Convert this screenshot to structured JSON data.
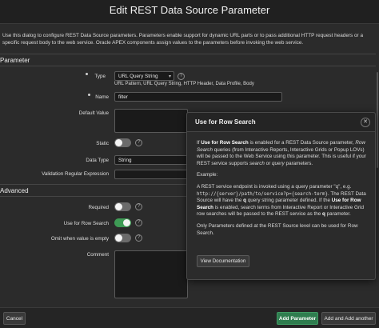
{
  "dialog": {
    "title": "Edit REST Data Source Parameter",
    "intro": "Use this dialog to configure REST Data Source parameters. Parameters enable support for dynamic URL parts or to pass additional HTTP request headers or a specific request body to the web service. Oracle APEX components assign values to the parameters before invoking the web service."
  },
  "parameter_section": {
    "heading": "Parameter",
    "type_label": "Type",
    "type_value": "URL Query String",
    "type_links": "URL Pattern, URL Query String, HTTP Header, Data Profile, Body",
    "name_label": "Name",
    "name_value": "filter",
    "default_label": "Default Value",
    "static_label": "Static",
    "datatype_label": "Data Type",
    "datatype_value": "String",
    "validation_label": "Validation Regular Expression"
  },
  "advanced_section": {
    "heading": "Advanced",
    "required_label": "Required",
    "row_search_label": "Use for Row Search",
    "omit_label": "Omit when value is empty",
    "comment_label": "Comment"
  },
  "toggles": {
    "static": false,
    "required": false,
    "row_search": true,
    "omit": false
  },
  "popup": {
    "title": "Use for Row Search",
    "close": "✕",
    "p1_a": "If ",
    "p1_b": "Use for Row Search",
    "p1_c": " is enabled for a REST Data Source parameter, ",
    "p1_d": "Row Search",
    "p1_e": " queries (from Interactive Reports, Interactive Grids or Popup LOVs) will be passed to the Web Service using this parameter. This is useful if your REST service supports ",
    "p1_f": "search",
    "p1_g": " or ",
    "p1_h": "query",
    "p1_i": " parameters.",
    "p2": "Example:",
    "p3_a": "A REST service endpoint is invoked using a query parameter \"q\", e.g. ",
    "p3_code": "http://{server}/path/to/service?p={search-term}",
    "p3_b": ". The REST Data Source will have the ",
    "p3_q": "q",
    "p3_c": " query string parameter defined. If the ",
    "p3_d": "Use for Row Search",
    "p3_e": " is enabled, search terms from Interactive Report or Interactive Grid row searches will be passed to the REST service as the ",
    "p3_q2": "q",
    "p3_f": " parameter.",
    "p4": "Only Parameters defined at the REST Source level can be used for Row Search.",
    "doc_button": "View Documentation"
  },
  "footer": {
    "cancel": "Cancel",
    "add": "Add Parameter",
    "add_another": "Add and Add another"
  },
  "help_glyph": "?"
}
